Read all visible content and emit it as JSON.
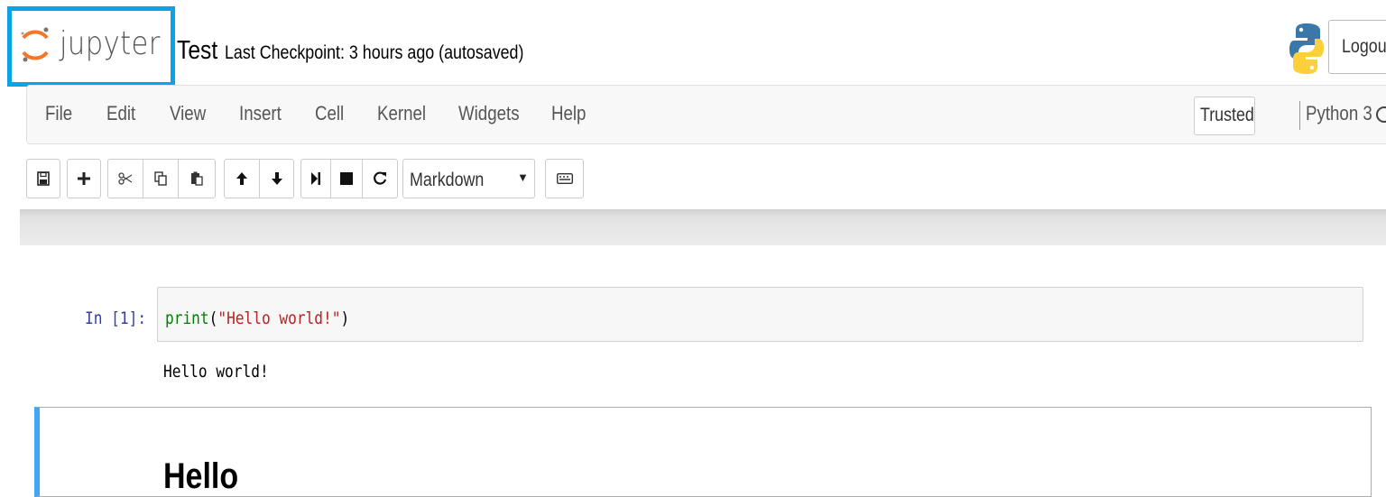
{
  "header": {
    "logo_text": "jupyter",
    "notebook_name": "Test",
    "checkpoint": "Last Checkpoint: 3 hours ago (autosaved)",
    "logout_label": "Logout",
    "logo_highlight_color": "#0aa3e8",
    "python_logo_icon": "python-logo-icon"
  },
  "menubar": {
    "items": [
      "File",
      "Edit",
      "View",
      "Insert",
      "Cell",
      "Kernel",
      "Widgets",
      "Help"
    ],
    "trusted_label": "Trusted",
    "kernel_name": "Python 3"
  },
  "toolbar": {
    "buttons": [
      {
        "name": "save-button",
        "icon": "floppy-disk-icon"
      },
      {
        "name": "insert-cell-below-button",
        "icon": "plus-icon"
      },
      {
        "name": "cut-cells-button",
        "icon": "scissors-icon"
      },
      {
        "name": "copy-cells-button",
        "icon": "copy-icon"
      },
      {
        "name": "paste-cells-button",
        "icon": "paste-icon"
      },
      {
        "name": "move-cell-up-button",
        "icon": "arrow-up-icon"
      },
      {
        "name": "move-cell-down-button",
        "icon": "arrow-down-icon"
      },
      {
        "name": "run-button",
        "icon": "step-forward-icon"
      },
      {
        "name": "interrupt-kernel-button",
        "icon": "stop-icon"
      },
      {
        "name": "restart-kernel-button",
        "icon": "restart-icon"
      },
      {
        "name": "command-palette-button",
        "icon": "keyboard-icon"
      }
    ],
    "cell_type_selected": "Markdown"
  },
  "cells": {
    "code_cell": {
      "prompt": "In [1]:",
      "code_builtin": "print",
      "code_open": "(",
      "code_string": "\"Hello world!\"",
      "code_close": ")",
      "output": "Hello world!"
    },
    "markdown_cell": {
      "heading": "Hello",
      "selected_border_color": "#42a5f5"
    }
  }
}
